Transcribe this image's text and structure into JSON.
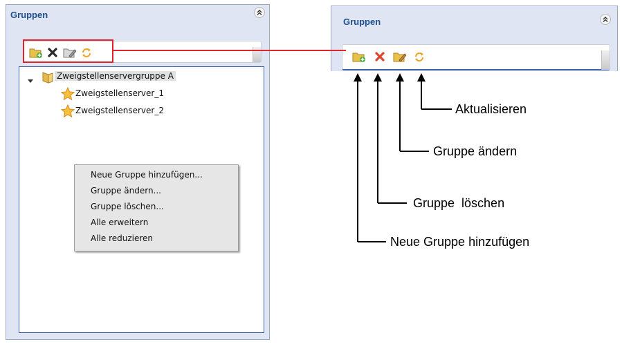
{
  "left_panel": {
    "title": "Gruppen",
    "collapse_icon": "double-chevron-up-icon",
    "toolbar_icons": [
      "folder-add-icon",
      "delete-x-icon",
      "folder-edit-icon",
      "refresh-icon"
    ],
    "tree": {
      "group": {
        "label": "Zweigstellenservergruppe A",
        "icon": "folder-icon",
        "expanded": true
      },
      "servers": [
        {
          "label": "Zweigstellenserver_1",
          "icon": "star-icon"
        },
        {
          "label": "Zweigstellenserver_2",
          "icon": "star-icon"
        }
      ]
    },
    "context_menu": [
      {
        "label": "Neue Gruppe hinzufügen..."
      },
      {
        "label": "Gruppe ändern..."
      },
      {
        "label": "Gruppe löschen..."
      },
      {
        "label": "Alle erweitern"
      },
      {
        "label": "Alle reduzieren"
      }
    ]
  },
  "right_panel": {
    "title": "Gruppen",
    "collapse_icon": "double-chevron-up-icon",
    "toolbar_icons": [
      "folder-add-icon",
      "delete-x-icon",
      "folder-edit-icon",
      "refresh-icon"
    ]
  },
  "callouts": {
    "refresh": "Aktualisieren",
    "edit": "Gruppe ändern",
    "delete": "Gruppe  löschen",
    "add": "Neue Gruppe hinzufügen"
  },
  "colors": {
    "panel_bg": "#dfe5f3",
    "title_blue": "#1f4f8f",
    "highlight_red": "#e0242c",
    "tree_border": "#3c63a8"
  }
}
